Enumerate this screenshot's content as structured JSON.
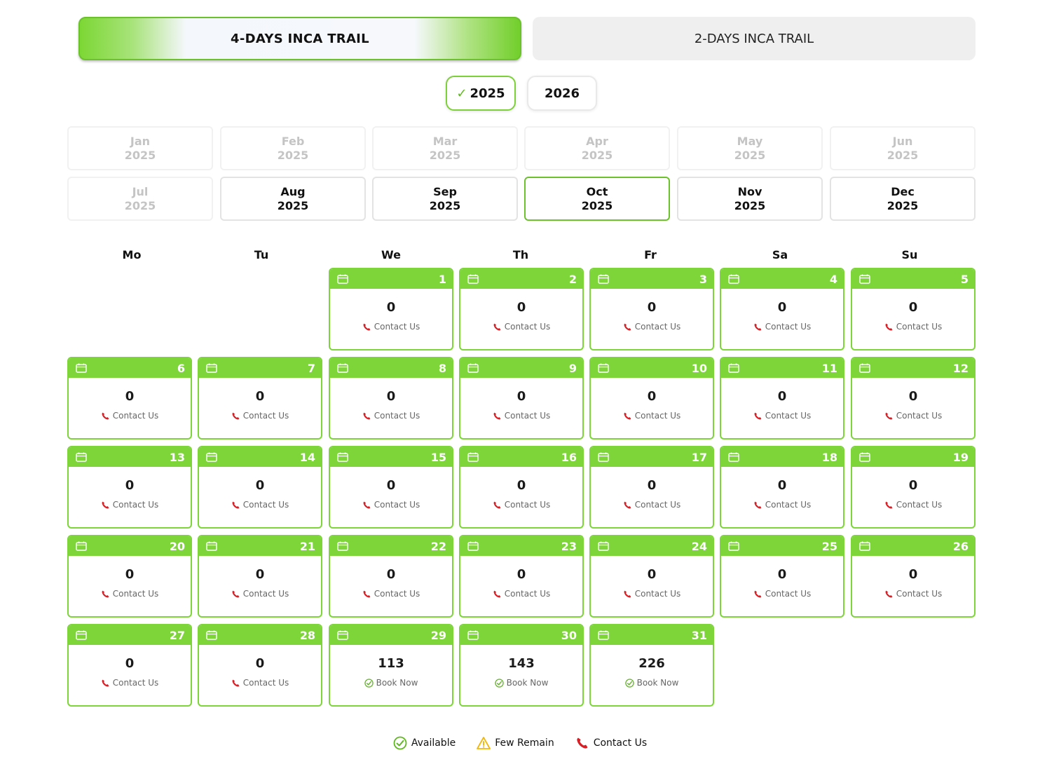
{
  "trail_tabs": [
    {
      "label": "4-DAYS INCA TRAIL",
      "active": true
    },
    {
      "label": "2-DAYS INCA TRAIL",
      "active": false
    }
  ],
  "years": [
    {
      "label": "2025",
      "selected": true
    },
    {
      "label": "2026",
      "selected": false
    }
  ],
  "months": [
    {
      "month": "Jan",
      "year": "2025",
      "state": "disabled"
    },
    {
      "month": "Feb",
      "year": "2025",
      "state": "disabled"
    },
    {
      "month": "Mar",
      "year": "2025",
      "state": "disabled"
    },
    {
      "month": "Apr",
      "year": "2025",
      "state": "disabled"
    },
    {
      "month": "May",
      "year": "2025",
      "state": "disabled"
    },
    {
      "month": "Jun",
      "year": "2025",
      "state": "disabled"
    },
    {
      "month": "Jul",
      "year": "2025",
      "state": "disabled"
    },
    {
      "month": "Aug",
      "year": "2025",
      "state": "enabled"
    },
    {
      "month": "Sep",
      "year": "2025",
      "state": "enabled"
    },
    {
      "month": "Oct",
      "year": "2025",
      "state": "selected"
    },
    {
      "month": "Nov",
      "year": "2025",
      "state": "enabled"
    },
    {
      "month": "Dec",
      "year": "2025",
      "state": "enabled"
    }
  ],
  "weekdays": [
    "Mo",
    "Tu",
    "We",
    "Th",
    "Fr",
    "Sa",
    "Su"
  ],
  "first_weekday_index": 2,
  "days": [
    {
      "day": "1",
      "count": "0",
      "status": "Contact Us",
      "type": "contact"
    },
    {
      "day": "2",
      "count": "0",
      "status": "Contact Us",
      "type": "contact"
    },
    {
      "day": "3",
      "count": "0",
      "status": "Contact Us",
      "type": "contact"
    },
    {
      "day": "4",
      "count": "0",
      "status": "Contact Us",
      "type": "contact"
    },
    {
      "day": "5",
      "count": "0",
      "status": "Contact Us",
      "type": "contact"
    },
    {
      "day": "6",
      "count": "0",
      "status": "Contact Us",
      "type": "contact"
    },
    {
      "day": "7",
      "count": "0",
      "status": "Contact Us",
      "type": "contact"
    },
    {
      "day": "8",
      "count": "0",
      "status": "Contact Us",
      "type": "contact"
    },
    {
      "day": "9",
      "count": "0",
      "status": "Contact Us",
      "type": "contact"
    },
    {
      "day": "10",
      "count": "0",
      "status": "Contact Us",
      "type": "contact"
    },
    {
      "day": "11",
      "count": "0",
      "status": "Contact Us",
      "type": "contact"
    },
    {
      "day": "12",
      "count": "0",
      "status": "Contact Us",
      "type": "contact"
    },
    {
      "day": "13",
      "count": "0",
      "status": "Contact Us",
      "type": "contact"
    },
    {
      "day": "14",
      "count": "0",
      "status": "Contact Us",
      "type": "contact"
    },
    {
      "day": "15",
      "count": "0",
      "status": "Contact Us",
      "type": "contact"
    },
    {
      "day": "16",
      "count": "0",
      "status": "Contact Us",
      "type": "contact"
    },
    {
      "day": "17",
      "count": "0",
      "status": "Contact Us",
      "type": "contact"
    },
    {
      "day": "18",
      "count": "0",
      "status": "Contact Us",
      "type": "contact"
    },
    {
      "day": "19",
      "count": "0",
      "status": "Contact Us",
      "type": "contact"
    },
    {
      "day": "20",
      "count": "0",
      "status": "Contact Us",
      "type": "contact"
    },
    {
      "day": "21",
      "count": "0",
      "status": "Contact Us",
      "type": "contact"
    },
    {
      "day": "22",
      "count": "0",
      "status": "Contact Us",
      "type": "contact"
    },
    {
      "day": "23",
      "count": "0",
      "status": "Contact Us",
      "type": "contact"
    },
    {
      "day": "24",
      "count": "0",
      "status": "Contact Us",
      "type": "contact"
    },
    {
      "day": "25",
      "count": "0",
      "status": "Contact Us",
      "type": "contact"
    },
    {
      "day": "26",
      "count": "0",
      "status": "Contact Us",
      "type": "contact"
    },
    {
      "day": "27",
      "count": "0",
      "status": "Contact Us",
      "type": "contact"
    },
    {
      "day": "28",
      "count": "0",
      "status": "Contact Us",
      "type": "contact"
    },
    {
      "day": "29",
      "count": "113",
      "status": "Book Now",
      "type": "available"
    },
    {
      "day": "30",
      "count": "143",
      "status": "Book Now",
      "type": "available"
    },
    {
      "day": "31",
      "count": "226",
      "status": "Book Now",
      "type": "available"
    }
  ],
  "legend": [
    {
      "label": "Available",
      "icon": "check-circle-icon",
      "color": "#5fb820"
    },
    {
      "label": "Few Remain",
      "icon": "warning-triangle-icon",
      "color": "#f2b70a"
    },
    {
      "label": "Contact Us",
      "icon": "phone-icon",
      "color": "#d91f26"
    }
  ],
  "colors": {
    "accent": "#7dd53a",
    "phone": "#d91f26",
    "available": "#5fb820",
    "warning": "#f2b70a"
  }
}
